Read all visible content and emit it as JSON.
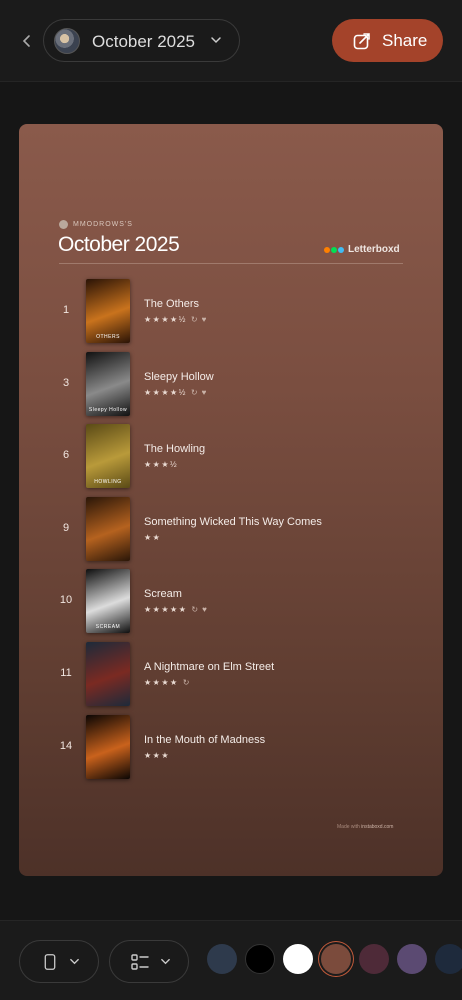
{
  "header": {
    "month_label": "October 2025",
    "share_label": "Share"
  },
  "card": {
    "username": "MMODROWS'S",
    "title": "October 2025",
    "brand": "Letterboxd",
    "footer_prefix": "Made with ",
    "footer_link": "instaboxd.com",
    "films": [
      {
        "rank": "1",
        "title": "The Others",
        "rating": "★★★★½",
        "rewatch": true,
        "liked": true,
        "poster_colors": [
          "#2a1306",
          "#c9731d"
        ],
        "poster_text": "OTHERS"
      },
      {
        "rank": "3",
        "title": "Sleepy Hollow",
        "rating": "★★★★½",
        "rewatch": true,
        "liked": true,
        "poster_colors": [
          "#111111",
          "#8a8a8a"
        ],
        "poster_text": "Sleepy Hollow"
      },
      {
        "rank": "6",
        "title": "The Howling",
        "rating": "★★★½",
        "rewatch": false,
        "liked": false,
        "poster_colors": [
          "#5a4a16",
          "#b99a3a"
        ],
        "poster_text": "HOWLING"
      },
      {
        "rank": "9",
        "title": "Something Wicked This Way Comes",
        "rating": "★★",
        "rewatch": false,
        "liked": false,
        "poster_colors": [
          "#2a1608",
          "#b5621f"
        ],
        "poster_text": ""
      },
      {
        "rank": "10",
        "title": "Scream",
        "rating": "★★★★★",
        "rewatch": true,
        "liked": true,
        "poster_colors": [
          "#0e0e0e",
          "#dcdcdc"
        ],
        "poster_text": "SCREAM"
      },
      {
        "rank": "11",
        "title": "A Nightmare on Elm Street",
        "rating": "★★★★",
        "rewatch": true,
        "liked": false,
        "poster_colors": [
          "#1d2a3a",
          "#7b2a22"
        ],
        "poster_text": ""
      },
      {
        "rank": "14",
        "title": "In the Mouth of Madness",
        "rating": "★★★",
        "rewatch": false,
        "liked": false,
        "poster_colors": [
          "#0b0604",
          "#c9621c"
        ],
        "poster_text": ""
      }
    ]
  },
  "icons": {
    "back": "chevron-left-icon",
    "month_dropdown": "chevron-down-icon",
    "share": "share-icon",
    "rewatch": "↻",
    "liked": "♥",
    "device": "phone-icon",
    "layout": "list-layout-icon"
  },
  "swatches": [
    "#2e3a4c",
    "#000000",
    "#ffffff",
    "#7b4b3c",
    "#4e2a38",
    "#5b4a72",
    "#1e2a3c"
  ],
  "selected_swatch_index": 3,
  "colors": {
    "accent": "#a4432a",
    "letterboxd_orange": "#ff8000",
    "letterboxd_green": "#00e054",
    "letterboxd_blue": "#40bcf4"
  }
}
